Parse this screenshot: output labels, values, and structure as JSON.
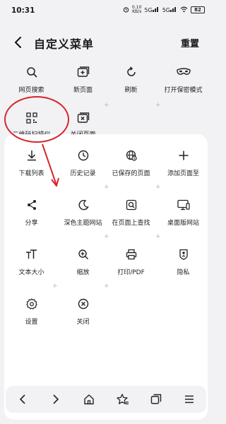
{
  "status": {
    "time": "10:31",
    "speed_value": "0.10",
    "speed_unit": "KB/s",
    "signal1": "5G",
    "signal2": "5G",
    "battery": "82"
  },
  "header": {
    "title": "自定义菜单",
    "reset": "重置"
  },
  "top_items": [
    {
      "label": "网页搜索",
      "icon": "search-icon"
    },
    {
      "label": "新页面",
      "icon": "new-tab-icon"
    },
    {
      "label": "刷新",
      "icon": "refresh-icon"
    },
    {
      "label": "打开保密模式",
      "icon": "incognito-mask-icon"
    },
    {
      "label": "二维码扫描仪",
      "icon": "qr-code-icon"
    },
    {
      "label": "关闭页面",
      "icon": "close-tab-icon"
    }
  ],
  "bottom_items": [
    {
      "label": "下载列表",
      "icon": "download-icon"
    },
    {
      "label": "历史记录",
      "icon": "clock-icon"
    },
    {
      "label": "已保存的页面",
      "icon": "globe-save-icon"
    },
    {
      "label": "添加页面至",
      "icon": "plus-icon"
    },
    {
      "label": "分享",
      "icon": "share-icon"
    },
    {
      "label": "深色主题网站",
      "icon": "moon-icon"
    },
    {
      "label": "在页面上查找",
      "icon": "find-in-page-icon"
    },
    {
      "label": "桌面版网站",
      "icon": "desktop-icon"
    },
    {
      "label": "文本大小",
      "icon": "text-size-icon"
    },
    {
      "label": "缩放",
      "icon": "zoom-in-icon"
    },
    {
      "label": "打印/PDF",
      "icon": "printer-icon"
    },
    {
      "label": "隐私",
      "icon": "privacy-icon"
    },
    {
      "label": "设置",
      "icon": "gear-icon"
    },
    {
      "label": "关闭",
      "icon": "close-circle-icon"
    }
  ],
  "nav": [
    {
      "icon": "back-arrow-icon"
    },
    {
      "icon": "forward-arrow-icon"
    },
    {
      "icon": "home-icon"
    },
    {
      "icon": "bookmark-star-icon"
    },
    {
      "icon": "tabs-icon"
    },
    {
      "icon": "menu-icon"
    }
  ],
  "colors": {
    "background": "#f2f2f4",
    "panel": "#ffffff",
    "annotation": "#d8262b",
    "text": "#1a1a1a"
  }
}
